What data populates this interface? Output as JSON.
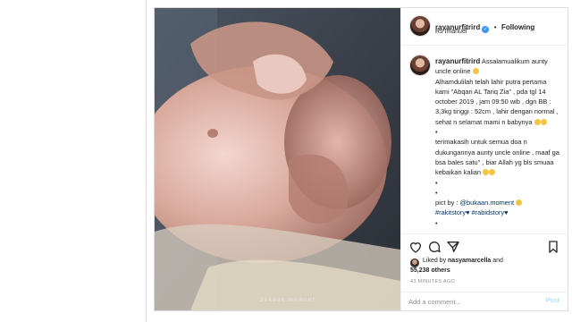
{
  "post": {
    "username": "rayanurfitrird",
    "follow_label": "Following",
    "separator": "•",
    "location": "Rs Imanuel",
    "photo_watermark": "bukaan.moment"
  },
  "caption": {
    "username": "rayanurfitrird",
    "lines": [
      "Assalamualikum aunty uncle online",
      "Alhamdulilah telah lahir putra pertama kami \"Abqari AL Tariq Zia\" , pda tgl 14 october 2019 , jam 09:50 wib , dgn BB : 3,3kg tinggi : 52cm , lahir dengan normal , sehat n selamat mami n babynya",
      "•",
      "terimakasih untuk semua doa n dukungannya aunty uncle online , maaf ga bsa bales satu\" , biar Allah yg bls smuaa kebaikan kalian",
      "•",
      "•",
      "pict by : "
    ],
    "pict_handle": "@bukaan.moment",
    "hashtags": "#rakitstory♥ #rabidstory♥",
    "more_indicator": "•"
  },
  "engagement": {
    "liked_by_prefix": "Liked by",
    "liked_by_user": "nasyamarcella",
    "liked_and": "and",
    "others": "55,238 others",
    "timestamp": "43 MINUTES AGO"
  },
  "comment": {
    "placeholder": "Add a comment...",
    "post_label": "Post"
  },
  "icons": [
    "heart-icon",
    "comment-icon",
    "share-icon",
    "bookmark-icon",
    "verified-badge-icon"
  ],
  "colors": {
    "verified": "#3897f0",
    "link": "#003569",
    "post_disabled": "#b2dffc",
    "muted": "#8e8e8e"
  }
}
